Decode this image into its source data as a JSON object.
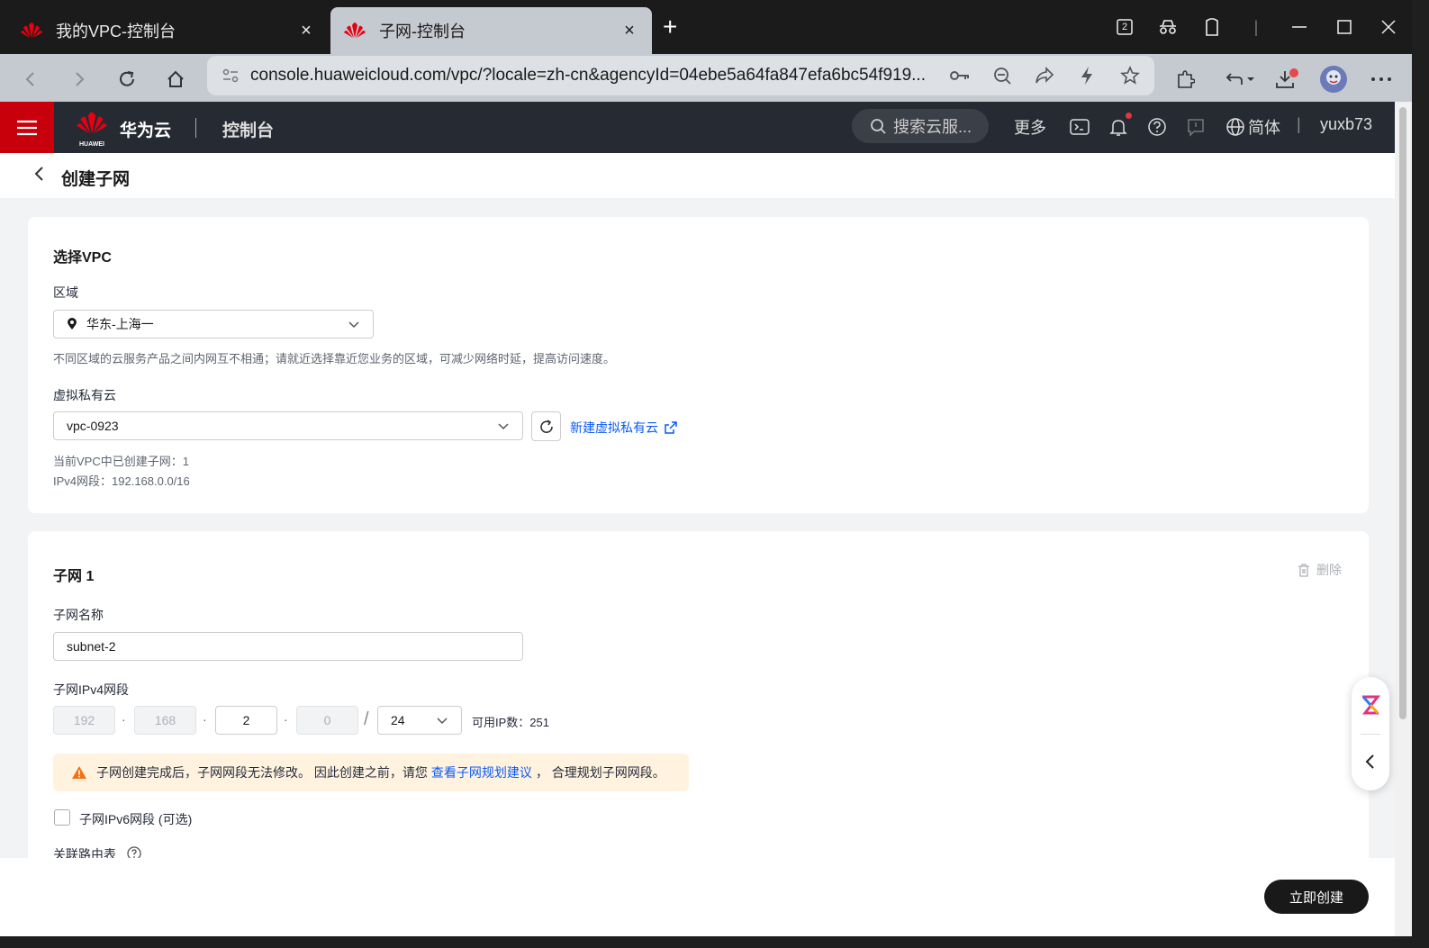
{
  "browser": {
    "tabs": [
      {
        "title": "我的VPC-控制台",
        "close": "×"
      },
      {
        "title": "子网-控制台",
        "close": "×"
      }
    ],
    "new_tab": "+",
    "tab_count": "2",
    "url": "console.huaweicloud.com/vpc/?locale=zh-cn&agencyId=04ebe5a64fa847efa6bc54f919..."
  },
  "header": {
    "brand": "华为云",
    "logo_text": "HUAWEI",
    "console": "控制台",
    "search_placeholder": "搜索云服...",
    "more": "更多",
    "language": "简体",
    "user": "yuxb73"
  },
  "page": {
    "title": "创建子网"
  },
  "vpc_section": {
    "title": "选择VPC",
    "region_label": "区域",
    "region_value": "华东-上海一",
    "region_hint": "不同区域的云服务产品之间内网互不相通；请就近选择靠近您业务的区域，可减少网络时延，提高访问速度。",
    "vpc_label": "虚拟私有云",
    "vpc_value": "vpc-0923",
    "new_vpc_link": "新建虚拟私有云",
    "subnet_count": "当前VPC中已创建子网：1",
    "ipv4_range": "IPv4网段：192.168.0.0/16"
  },
  "subnet": {
    "title": "子网 1",
    "delete": "删除",
    "name_label": "子网名称",
    "name_value": "subnet-2",
    "ipv4_label": "子网IPv4网段",
    "octet1": "192",
    "octet2": "168",
    "octet3": "2",
    "octet4": "0",
    "dot": "·",
    "slash": "/",
    "mask": "24",
    "available_ips": "可用IP数：251",
    "warning_text": "子网创建完成后，子网网段无法修改。 因此创建之前，请您",
    "warning_link": "查看子网规划建议",
    "warning_tail": "，  合理规划子网网段。",
    "ipv6_label": "子网IPv6网段 (可选)",
    "route_label": "关联路由表"
  },
  "footer": {
    "create_button": "立即创建"
  },
  "colors": {
    "brand_red": "#c7000b",
    "link_blue": "#0a59f7",
    "header_bg": "#252a33"
  }
}
